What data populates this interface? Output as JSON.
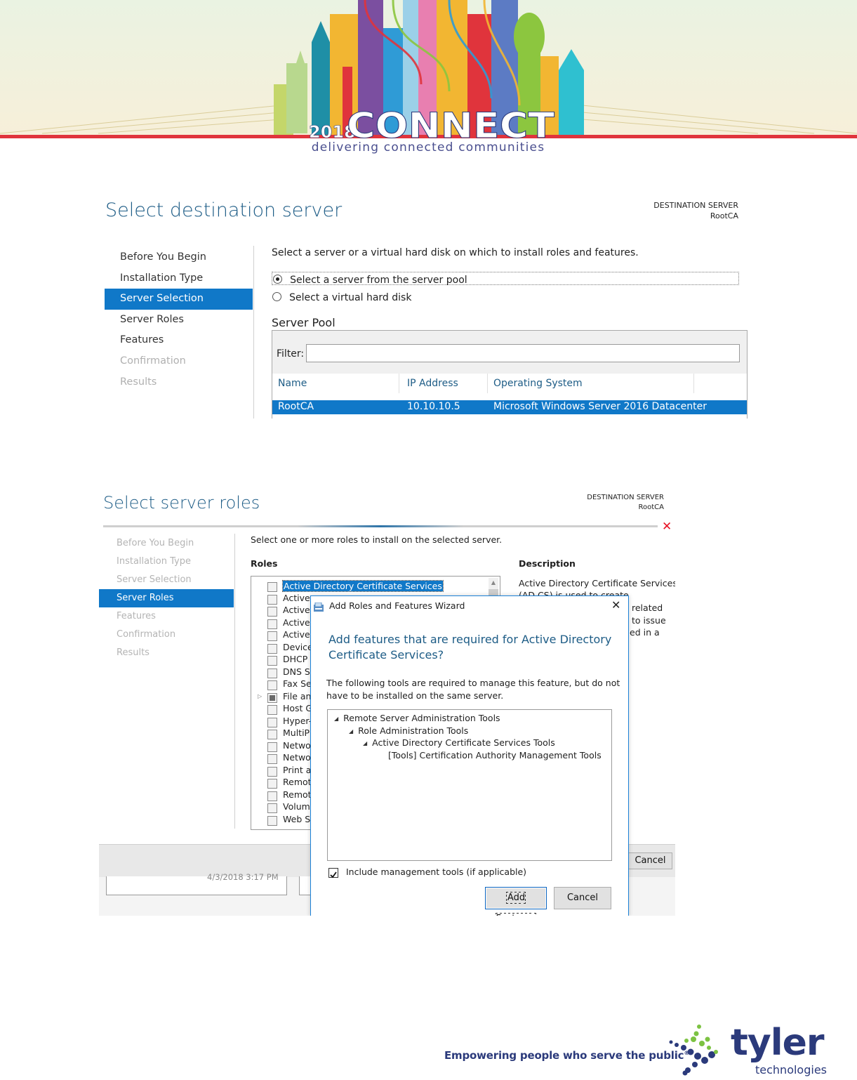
{
  "banner": {
    "year": "2018",
    "brand": "CONNECT",
    "tagline": "delivering connected communities"
  },
  "shot1": {
    "title": "Select destination server",
    "dest_label": "DESTINATION SERVER",
    "dest_server": "RootCA",
    "steps": [
      {
        "label": "Before You Begin",
        "state": "normal"
      },
      {
        "label": "Installation Type",
        "state": "normal"
      },
      {
        "label": "Server Selection",
        "state": "active"
      },
      {
        "label": "Server Roles",
        "state": "normal"
      },
      {
        "label": "Features",
        "state": "normal"
      },
      {
        "label": "Confirmation",
        "state": "disabled"
      },
      {
        "label": "Results",
        "state": "disabled"
      }
    ],
    "instruction": "Select a server or a virtual hard disk on which to install roles and features.",
    "radio_pool": "Select a server from the server pool",
    "radio_vhd": "Select a virtual hard disk",
    "pool_title": "Server Pool",
    "filter_label": "Filter:",
    "filter_value": "",
    "columns": [
      "Name",
      "IP Address",
      "Operating System"
    ],
    "rows": [
      {
        "name": "RootCA",
        "ip": "10.10.10.5",
        "os": "Microsoft Windows Server 2016 Datacenter"
      }
    ]
  },
  "shot2": {
    "title": "Select server roles",
    "dest_label": "DESTINATION SERVER",
    "dest_server": "RootCA",
    "steps": [
      {
        "label": "Before You Begin",
        "state": "disabled"
      },
      {
        "label": "Installation Type",
        "state": "disabled"
      },
      {
        "label": "Server Selection",
        "state": "disabled"
      },
      {
        "label": "Server Roles",
        "state": "active"
      },
      {
        "label": "Features",
        "state": "disabled"
      },
      {
        "label": "Confirmation",
        "state": "disabled"
      },
      {
        "label": "Results",
        "state": "disabled"
      }
    ],
    "instruction": "Select one or more roles to install on the selected server.",
    "roles_header": "Roles",
    "description_header": "Description",
    "roles": [
      "Active Directory Certificate Services",
      "Active",
      "Active",
      "Active",
      "Active",
      "Device",
      "DHCP",
      "DNS S",
      "Fax Se",
      "File an",
      "Host G",
      "Hyper-",
      "MultiP",
      "Netwo",
      "Netwo",
      "Print a",
      "Remot",
      "Remot",
      "Volum",
      "Web S"
    ],
    "description_lines": [
      "Active Directory Certificate Services",
      "(AD CS) is used to create",
      "related",
      "to issue",
      "ed in a"
    ],
    "cancel_label": "Cancel",
    "timestamp": "4/3/2018 3:17 PM",
    "close_glyph": "✕"
  },
  "dialog": {
    "window_title": "Add Roles and Features Wizard",
    "heading_line1": "Add features that are required for Active Directory",
    "heading_line2": "Certificate Services?",
    "body_line1": "The following tools are required to manage this feature, but do not",
    "body_line2": "have to be installed on the same server.",
    "tree": [
      {
        "label": "Remote Server Administration Tools",
        "level": 0,
        "expanded": true
      },
      {
        "label": "Role Administration Tools",
        "level": 1,
        "expanded": true
      },
      {
        "label": "Active Directory Certificate Services Tools",
        "level": 2,
        "expanded": true
      },
      {
        "label": "[Tools] Certification Authority Management Tools",
        "level": 3,
        "expanded": false
      }
    ],
    "include_tools_label": "Include management tools (if applicable)",
    "include_tools_checked": true,
    "add_button": "Add Features",
    "cancel_button": "Cancel",
    "close_glyph": "✕"
  },
  "footer": {
    "slogan": "Empowering people who serve the public",
    "registered": "®",
    "brand": "tyler",
    "brand_sub": "technologies"
  },
  "colors": {
    "accent_blue": "#1078c8",
    "title_blue": "#1d5c86",
    "banner_red": "#e0343c",
    "tyler_navy": "#2b3a7b",
    "tyler_green": "#7cc242"
  }
}
